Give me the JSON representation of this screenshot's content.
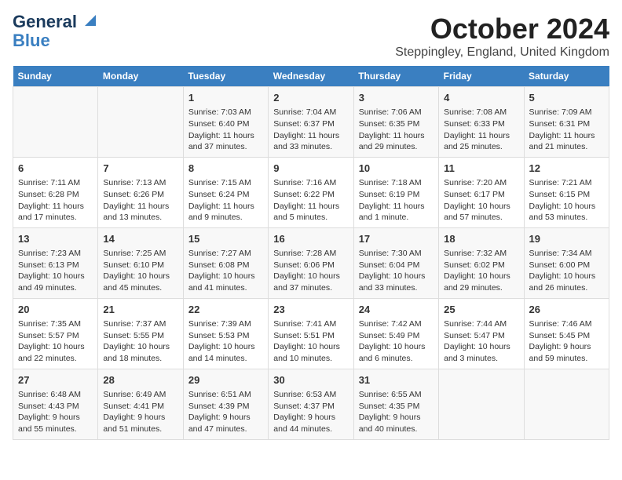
{
  "header": {
    "logo_line1": "General",
    "logo_line2": "Blue",
    "month_title": "October 2024",
    "location": "Steppingley, England, United Kingdom"
  },
  "days_of_week": [
    "Sunday",
    "Monday",
    "Tuesday",
    "Wednesday",
    "Thursday",
    "Friday",
    "Saturday"
  ],
  "weeks": [
    [
      {
        "day": "",
        "content": ""
      },
      {
        "day": "",
        "content": ""
      },
      {
        "day": "1",
        "content": "Sunrise: 7:03 AM\nSunset: 6:40 PM\nDaylight: 11 hours and 37 minutes."
      },
      {
        "day": "2",
        "content": "Sunrise: 7:04 AM\nSunset: 6:37 PM\nDaylight: 11 hours and 33 minutes."
      },
      {
        "day": "3",
        "content": "Sunrise: 7:06 AM\nSunset: 6:35 PM\nDaylight: 11 hours and 29 minutes."
      },
      {
        "day": "4",
        "content": "Sunrise: 7:08 AM\nSunset: 6:33 PM\nDaylight: 11 hours and 25 minutes."
      },
      {
        "day": "5",
        "content": "Sunrise: 7:09 AM\nSunset: 6:31 PM\nDaylight: 11 hours and 21 minutes."
      }
    ],
    [
      {
        "day": "6",
        "content": "Sunrise: 7:11 AM\nSunset: 6:28 PM\nDaylight: 11 hours and 17 minutes."
      },
      {
        "day": "7",
        "content": "Sunrise: 7:13 AM\nSunset: 6:26 PM\nDaylight: 11 hours and 13 minutes."
      },
      {
        "day": "8",
        "content": "Sunrise: 7:15 AM\nSunset: 6:24 PM\nDaylight: 11 hours and 9 minutes."
      },
      {
        "day": "9",
        "content": "Sunrise: 7:16 AM\nSunset: 6:22 PM\nDaylight: 11 hours and 5 minutes."
      },
      {
        "day": "10",
        "content": "Sunrise: 7:18 AM\nSunset: 6:19 PM\nDaylight: 11 hours and 1 minute."
      },
      {
        "day": "11",
        "content": "Sunrise: 7:20 AM\nSunset: 6:17 PM\nDaylight: 10 hours and 57 minutes."
      },
      {
        "day": "12",
        "content": "Sunrise: 7:21 AM\nSunset: 6:15 PM\nDaylight: 10 hours and 53 minutes."
      }
    ],
    [
      {
        "day": "13",
        "content": "Sunrise: 7:23 AM\nSunset: 6:13 PM\nDaylight: 10 hours and 49 minutes."
      },
      {
        "day": "14",
        "content": "Sunrise: 7:25 AM\nSunset: 6:10 PM\nDaylight: 10 hours and 45 minutes."
      },
      {
        "day": "15",
        "content": "Sunrise: 7:27 AM\nSunset: 6:08 PM\nDaylight: 10 hours and 41 minutes."
      },
      {
        "day": "16",
        "content": "Sunrise: 7:28 AM\nSunset: 6:06 PM\nDaylight: 10 hours and 37 minutes."
      },
      {
        "day": "17",
        "content": "Sunrise: 7:30 AM\nSunset: 6:04 PM\nDaylight: 10 hours and 33 minutes."
      },
      {
        "day": "18",
        "content": "Sunrise: 7:32 AM\nSunset: 6:02 PM\nDaylight: 10 hours and 29 minutes."
      },
      {
        "day": "19",
        "content": "Sunrise: 7:34 AM\nSunset: 6:00 PM\nDaylight: 10 hours and 26 minutes."
      }
    ],
    [
      {
        "day": "20",
        "content": "Sunrise: 7:35 AM\nSunset: 5:57 PM\nDaylight: 10 hours and 22 minutes."
      },
      {
        "day": "21",
        "content": "Sunrise: 7:37 AM\nSunset: 5:55 PM\nDaylight: 10 hours and 18 minutes."
      },
      {
        "day": "22",
        "content": "Sunrise: 7:39 AM\nSunset: 5:53 PM\nDaylight: 10 hours and 14 minutes."
      },
      {
        "day": "23",
        "content": "Sunrise: 7:41 AM\nSunset: 5:51 PM\nDaylight: 10 hours and 10 minutes."
      },
      {
        "day": "24",
        "content": "Sunrise: 7:42 AM\nSunset: 5:49 PM\nDaylight: 10 hours and 6 minutes."
      },
      {
        "day": "25",
        "content": "Sunrise: 7:44 AM\nSunset: 5:47 PM\nDaylight: 10 hours and 3 minutes."
      },
      {
        "day": "26",
        "content": "Sunrise: 7:46 AM\nSunset: 5:45 PM\nDaylight: 9 hours and 59 minutes."
      }
    ],
    [
      {
        "day": "27",
        "content": "Sunrise: 6:48 AM\nSunset: 4:43 PM\nDaylight: 9 hours and 55 minutes."
      },
      {
        "day": "28",
        "content": "Sunrise: 6:49 AM\nSunset: 4:41 PM\nDaylight: 9 hours and 51 minutes."
      },
      {
        "day": "29",
        "content": "Sunrise: 6:51 AM\nSunset: 4:39 PM\nDaylight: 9 hours and 47 minutes."
      },
      {
        "day": "30",
        "content": "Sunrise: 6:53 AM\nSunset: 4:37 PM\nDaylight: 9 hours and 44 minutes."
      },
      {
        "day": "31",
        "content": "Sunrise: 6:55 AM\nSunset: 4:35 PM\nDaylight: 9 hours and 40 minutes."
      },
      {
        "day": "",
        "content": ""
      },
      {
        "day": "",
        "content": ""
      }
    ]
  ]
}
